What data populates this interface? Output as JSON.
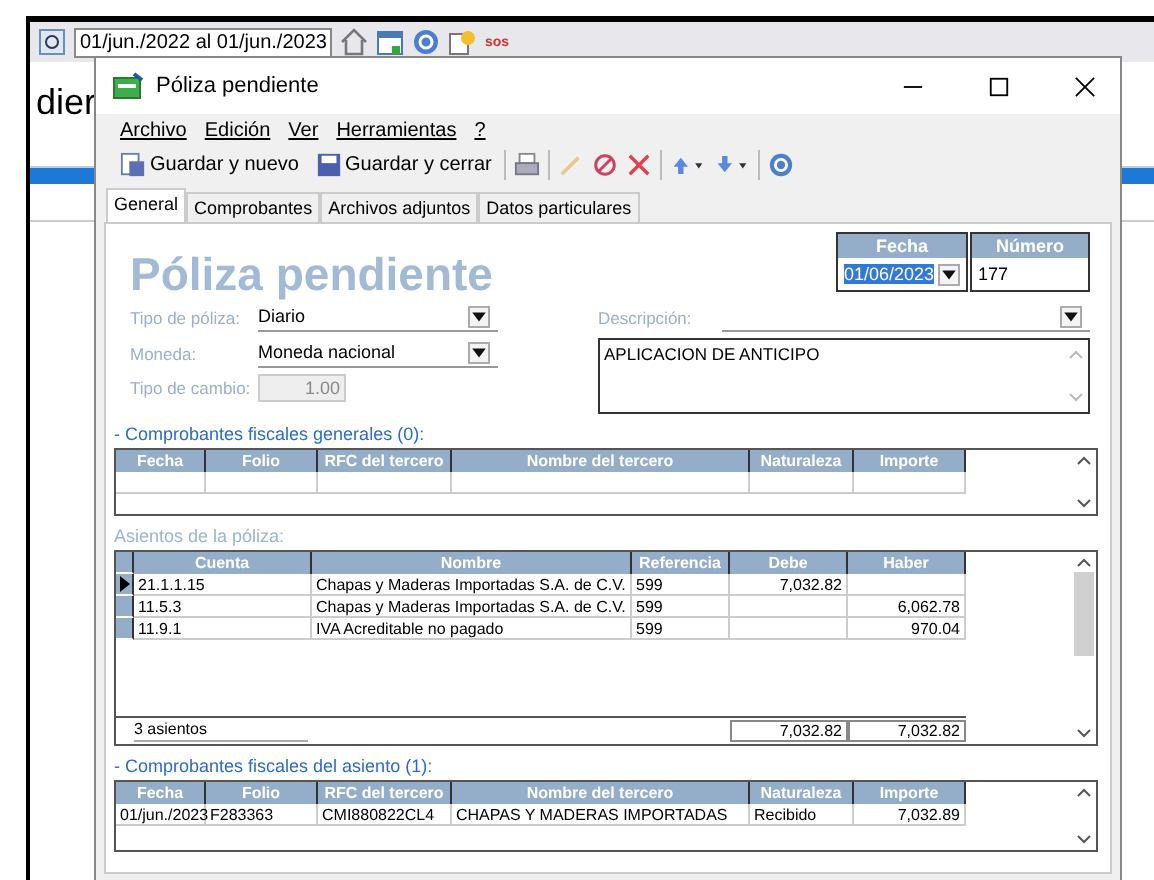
{
  "background_app": {
    "date_range": "01/jun./2022 al 01/jun./2023",
    "sos": "sos",
    "heading_fragment": "dier"
  },
  "window": {
    "title": "Póliza pendiente"
  },
  "menu": [
    "Archivo",
    "Edición",
    "Ver",
    "Herramientas",
    "?"
  ],
  "toolbar": [
    {
      "kind": "save-new",
      "label": "Guardar y nuevo"
    },
    {
      "kind": "save",
      "label": "Guardar y cerrar"
    },
    {
      "kind": "separator"
    },
    {
      "kind": "print"
    },
    {
      "kind": "separator"
    },
    {
      "kind": "edit",
      "disabled": true
    },
    {
      "kind": "cancel"
    },
    {
      "kind": "delete"
    },
    {
      "kind": "separator"
    },
    {
      "kind": "up"
    },
    {
      "kind": "down"
    },
    {
      "kind": "separator"
    },
    {
      "kind": "help"
    }
  ],
  "tabs": [
    {
      "label": "General",
      "selected": true
    },
    {
      "label": "Comprobantes",
      "selected": false
    },
    {
      "label": "Archivos adjuntos",
      "selected": false
    },
    {
      "label": "Datos particulares",
      "selected": false
    }
  ],
  "form": {
    "title": "Póliza pendiente",
    "fecha": {
      "label": "Fecha",
      "value": "01/06/2023"
    },
    "numero": {
      "label": "Número",
      "value": "177"
    },
    "tipo_poliza": {
      "label": "Tipo de póliza:",
      "value": "Diario"
    },
    "moneda": {
      "label": "Moneda:",
      "value": "Moneda nacional"
    },
    "tipo_cambio": {
      "label": "Tipo de cambio:",
      "value": "1.00",
      "disabled": true
    },
    "descripcion": {
      "label": "Descripción:",
      "value": "APLICACION DE ANTICIPO"
    }
  },
  "general_receipts": {
    "heading": "- Comprobantes fiscales generales (0):",
    "columns": [
      "Fecha",
      "Folio",
      "RFC del tercero",
      "Nombre del tercero",
      "Naturaleza",
      "Importe"
    ]
  },
  "entries": {
    "heading": "Asientos de la póliza:",
    "columns": [
      "Cuenta",
      "Nombre",
      "Referencia",
      "Debe",
      "Haber"
    ],
    "rows": [
      {
        "selected": true,
        "cells": [
          "21.1.1.15",
          "Chapas y Maderas Importadas S.A. de C.V.",
          "599",
          "7,032.82",
          ""
        ]
      },
      {
        "selected": false,
        "cells": [
          "11.5.3",
          "Chapas y Maderas Importadas S.A. de C.V.",
          "599",
          "",
          "6,062.78"
        ]
      },
      {
        "selected": false,
        "cells": [
          "11.9.1",
          "IVA Acreditable no pagado",
          "599",
          "",
          "970.04"
        ]
      }
    ],
    "footer": {
      "count": "3 asientos",
      "debe": "7,032.82",
      "haber": "7,032.82"
    }
  },
  "entry_receipts": {
    "heading": "- Comprobantes fiscales del asiento (1):",
    "columns": [
      "Fecha",
      "Folio",
      "RFC del tercero",
      "Nombre del tercero",
      "Naturaleza",
      "Importe"
    ],
    "rows": [
      [
        "01/jun./2023",
        "F283363",
        "CMI880822CL4",
        "CHAPAS Y MADERAS IMPORTADAS",
        "Recibido",
        "7,032.89"
      ]
    ]
  }
}
